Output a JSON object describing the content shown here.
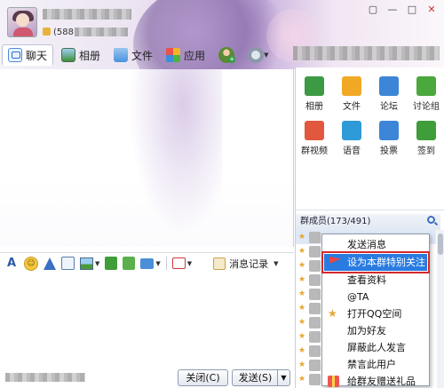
{
  "header": {
    "group_id": "(588",
    "window_buttons": [
      "chat-bubble",
      "minimize",
      "maximize",
      "close"
    ]
  },
  "tabs": [
    {
      "label": "聊天",
      "icon": "chat-icon"
    },
    {
      "label": "相册",
      "icon": "photo-album-icon"
    },
    {
      "label": "文件",
      "icon": "folder-icon"
    },
    {
      "label": "应用",
      "icon": "app-icon"
    }
  ],
  "apps": [
    {
      "label": "相册",
      "color": "#3c9a45",
      "icon": "photo-icon"
    },
    {
      "label": "文件",
      "color": "#f1a925",
      "icon": "folder-icon"
    },
    {
      "label": "论坛",
      "color": "#3d85d6",
      "icon": "forum-icon"
    },
    {
      "label": "讨论组",
      "color": "#4aa83c",
      "icon": "discussion-icon"
    },
    {
      "label": "群视频",
      "color": "#e2583e",
      "icon": "video-icon"
    },
    {
      "label": "语音",
      "color": "#2f9ad8",
      "icon": "voice-icon"
    },
    {
      "label": "投票",
      "color": "#3d85d6",
      "icon": "vote-icon"
    },
    {
      "label": "签到",
      "color": "#3f9e3a",
      "icon": "checkin-icon"
    }
  ],
  "members": {
    "title": "群成员(173/491)",
    "rows": 11
  },
  "toolbar": {
    "history_label": "消息记录"
  },
  "buttons": {
    "close": "关闭(C)",
    "send": "发送(S)"
  },
  "context_menu": [
    {
      "label": "发送消息",
      "icon": ""
    },
    {
      "label": "设为本群特别关注",
      "icon": "flag",
      "highlighted": true
    },
    {
      "label": "查看资料",
      "icon": ""
    },
    {
      "label": "@TA",
      "icon": ""
    },
    {
      "label": "打开QQ空间",
      "icon": "star"
    },
    {
      "label": "加为好友",
      "icon": ""
    },
    {
      "label": "屏蔽此人发言",
      "icon": ""
    },
    {
      "label": "禁言此用户",
      "icon": ""
    },
    {
      "label": "给群友赠送礼品",
      "icon": "gift"
    }
  ]
}
